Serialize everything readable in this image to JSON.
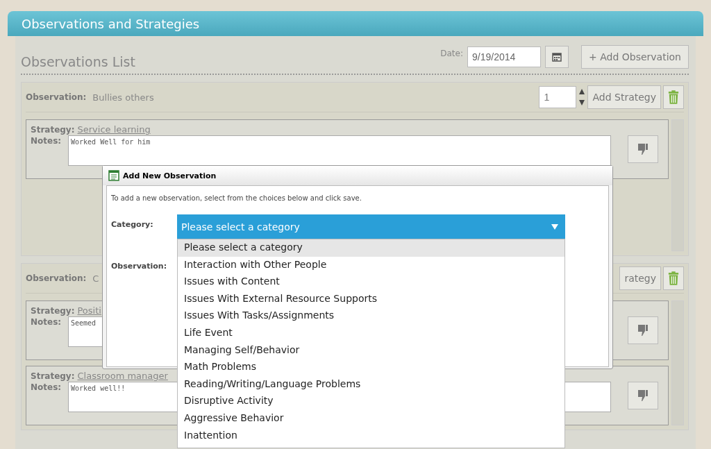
{
  "header": {
    "title": "Observations and Strategies"
  },
  "list": {
    "title": "Observations List",
    "date_label": "Date:",
    "date": "9/19/2014",
    "add_button": "+ Add Observation"
  },
  "observations": [
    {
      "label": "Observation:",
      "text": "Bullies others",
      "count": "1",
      "add_strategy": "Add Strategy",
      "strategies": [
        {
          "label": "Strategy:",
          "name": "Service learning",
          "notes_label": "Notes:",
          "notes": "Worked Well for him"
        }
      ]
    },
    {
      "label": "Observation:",
      "text": "C",
      "add_strategy": "rategy",
      "strategies": [
        {
          "label": "Strategy:",
          "name": "Positi",
          "notes_label": "Notes:",
          "notes": "Seemed"
        },
        {
          "label": "Strategy:",
          "name": "Classroom manager",
          "notes_label": "Notes:",
          "notes": "Worked well!!"
        }
      ]
    }
  ],
  "dialog": {
    "title": "Add New Observation",
    "intro": "To add a new observation, select from the choices below and click save.",
    "category_label": "Category:",
    "observation_label": "Observation:",
    "selected": "Please select a category",
    "options": [
      {
        "label": "Please select a category",
        "selected": true
      },
      {
        "label": "Interaction with Other People",
        "selected": false
      },
      {
        "label": "Issues with Content",
        "selected": false
      },
      {
        "label": "Issues With External Resource Supports",
        "selected": false
      },
      {
        "label": "Issues With Tasks/Assignments",
        "selected": false
      },
      {
        "label": "Life Event",
        "selected": false
      },
      {
        "label": "Managing Self/Behavior",
        "selected": false
      },
      {
        "label": "Math Problems",
        "selected": false
      },
      {
        "label": "Reading/Writing/Language Problems",
        "selected": false
      },
      {
        "label": "Disruptive Activity",
        "selected": false
      },
      {
        "label": "Aggressive Behavior",
        "selected": false
      },
      {
        "label": "Inattention",
        "selected": false
      }
    ]
  }
}
